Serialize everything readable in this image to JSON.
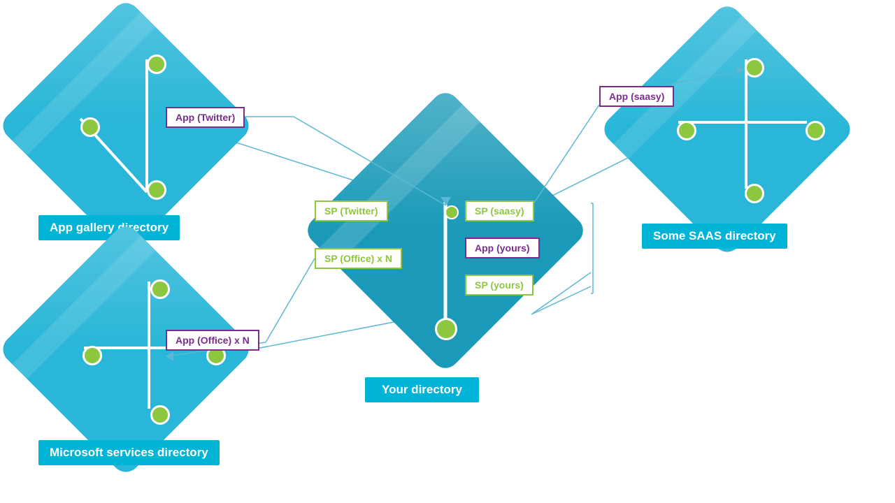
{
  "labels": {
    "app_gallery_directory": "App gallery directory",
    "microsoft_services_directory": "Microsoft services directory",
    "some_saas_directory": "Some SAAS directory",
    "your_directory": "Your directory",
    "app_twitter": "App (Twitter)",
    "app_office": "App (Office) x N",
    "app_saasy": "App (saasy)",
    "app_yours": "App (yours)",
    "sp_twitter": "SP (Twitter)",
    "sp_saasy": "SP (saasy)",
    "sp_office": "SP (Office) x N",
    "sp_yours": "SP (yours)"
  },
  "colors": {
    "diamond_light": "#29b6d8",
    "diamond_dark": "#1a9ab8",
    "diamond_stripe": "rgba(255,255,255,0.15)",
    "node_green": "#8dc63f",
    "label_teal_bg": "#00b4d8",
    "label_purple": "#7b2d8b",
    "label_green": "#8dc63f",
    "line_color": "#5bb8d4",
    "connector_line": "#5bb8d4"
  }
}
